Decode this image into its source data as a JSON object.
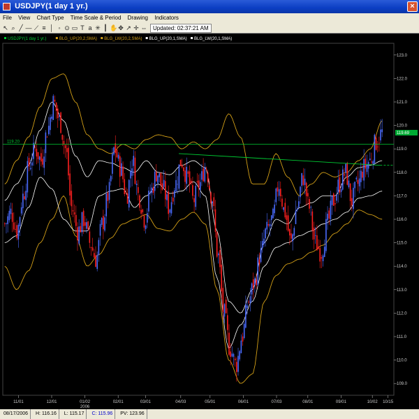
{
  "window": {
    "title": "USDJPY(1 day 1 yr.)",
    "close_glyph": "×"
  },
  "menu": [
    "File",
    "View",
    "Chart Type",
    "Time Scale & Period",
    "Drawing",
    "Indicators"
  ],
  "toolbar": {
    "icons": [
      "arrow-icon",
      "zoom-icon",
      "line-icon",
      "hline-icon",
      "ray-icon",
      "fib-icon",
      "pointer-icon",
      "circle-icon",
      "target-icon",
      "rect-icon",
      "text-icon",
      "abc-icon",
      "fan-icon",
      "vline-icon",
      "hand-icon",
      "move-icon",
      "cursor-icon",
      "cross-icon",
      "pan-icon",
      "zoomout-icon"
    ],
    "updated": "Updated: 02:37:21 AM"
  },
  "status": {
    "date": "08/17/2006",
    "high": "H: 116.16",
    "low": "L: 115.17",
    "close": "C: 115.96",
    "pv": "PV: 123.96"
  },
  "colors": {
    "up_candle": "#4a6bff",
    "down_candle": "#ff2020",
    "upper_band": "#d4a017",
    "mid_band": "#ffffff",
    "trendline": "#00cc33",
    "hline": "#00cc33"
  },
  "chart_data": {
    "type": "line",
    "legend": [
      {
        "name": "USDJPY(1 day 1 yr.)",
        "color": "#00cc33"
      },
      {
        "name": "BLG_UP(20,2,SMA)",
        "color": "#d4a017"
      },
      {
        "name": "BLG_LW(20,2,SMA)",
        "color": "#d4a017"
      },
      {
        "name": "BLG_UP(20,1,SMA)",
        "color": "#ffffff"
      },
      {
        "name": "BLG_LW(20,1,SMA)",
        "color": "#ffffff"
      }
    ],
    "ylim": [
      108.5,
      123.5
    ],
    "yticks": [
      109.0,
      110.0,
      111.0,
      112.0,
      113.0,
      114.0,
      115.0,
      116.0,
      117.0,
      118.0,
      119.0,
      120.0,
      121.0,
      122.0,
      123.0
    ],
    "ytick_labels": [
      "109.0",
      "110.0",
      "111.0",
      "112.0",
      "113.0",
      "114.0",
      "115.0",
      "116.0",
      "117.0",
      "118.0",
      "119.0",
      "120.0",
      "121.0",
      "122.0",
      "123.0"
    ],
    "xticks": [
      {
        "label": "11/01",
        "pos": 0.04
      },
      {
        "label": "12/01",
        "pos": 0.125
      },
      {
        "label": "01/02",
        "sub": "2006",
        "pos": 0.21
      },
      {
        "label": "02/01",
        "pos": 0.295
      },
      {
        "label": "03/01",
        "pos": 0.365
      },
      {
        "label": "04/03",
        "pos": 0.455
      },
      {
        "label": "05/01",
        "pos": 0.53
      },
      {
        "label": "06/01",
        "pos": 0.615
      },
      {
        "label": "07/03",
        "pos": 0.7
      },
      {
        "label": "08/01",
        "pos": 0.78
      },
      {
        "label": "09/01",
        "pos": 0.865
      },
      {
        "label": "10/02",
        "pos": 0.945
      },
      {
        "label": "10/15",
        "pos": 0.985
      }
    ],
    "price_path": [
      115.8,
      116.3,
      115.5,
      117.0,
      118.3,
      119.0,
      118.5,
      119.8,
      121.0,
      120.2,
      119.0,
      116.5,
      115.5,
      116.0,
      115.0,
      114.3,
      115.8,
      117.0,
      119.0,
      118.2,
      117.0,
      118.5,
      117.0,
      116.0,
      117.2,
      118.0,
      117.3,
      116.5,
      117.5,
      118.5,
      117.8,
      116.8,
      117.5,
      118.3,
      117.0,
      114.5,
      112.0,
      110.5,
      109.8,
      111.0,
      112.5,
      113.3,
      114.5,
      115.5,
      116.0,
      117.5,
      116.3,
      115.0,
      116.5,
      117.8,
      116.5,
      115.0,
      114.6,
      115.8,
      116.8,
      117.5,
      118.0,
      116.8,
      117.5,
      118.2,
      118.5,
      119.3,
      119.7
    ],
    "upper2": [
      117.5,
      118.5,
      119.5,
      120.8,
      122.0,
      122.2,
      121.0,
      119.6,
      119.0,
      118.8,
      119.2,
      119.0,
      119.4,
      119.6,
      119.5,
      119.0,
      119.3,
      119.0,
      119.4,
      120.5,
      119.5,
      117.5,
      117.5,
      118.8,
      117.8,
      117.0,
      117.5,
      118.0,
      117.8,
      118.0,
      118.5,
      119.0,
      120.2
    ],
    "mid1_up": [
      116.8,
      117.5,
      118.3,
      119.8,
      121.0,
      120.2,
      118.7,
      117.8,
      118.5,
      118.4,
      118.2,
      118.0,
      118.5,
      118.0,
      117.9,
      118.3,
      118.5,
      118.2,
      115.5,
      112.5,
      112.0,
      113.0,
      115.0,
      116.0,
      115.8,
      116.5,
      116.7,
      117.0,
      117.0,
      117.8,
      118.2,
      118.3,
      118.5
    ],
    "mid1_lw": [
      115.0,
      115.3,
      116.5,
      117.8,
      117.3,
      116.0,
      115.5,
      115.5,
      117.0,
      117.2,
      117.3,
      116.5,
      117.0,
      117.5,
      117.1,
      117.2,
      117.6,
      117.0,
      113.5,
      110.5,
      111.5,
      112.5,
      114.0,
      114.8,
      115.0,
      115.3,
      115.5,
      115.8,
      116.0,
      116.3,
      116.9,
      117.0,
      117.2
    ],
    "lower2": [
      114.0,
      113.0,
      113.8,
      115.0,
      116.0,
      117.0,
      115.3,
      114.0,
      114.5,
      115.2,
      115.8,
      116.0,
      116.2,
      115.6,
      115.5,
      116.0,
      116.3,
      115.8,
      113.0,
      110.0,
      109.0,
      109.4,
      112.5,
      113.6,
      114.1,
      114.3,
      114.6,
      114.9,
      115.4,
      115.8,
      116.4,
      116.2,
      116.0
    ],
    "hline": {
      "label": "119.20",
      "value": 119.2
    },
    "trendline": {
      "from": [
        0.45,
        118.8
      ],
      "to": [
        0.965,
        118.3
      ]
    },
    "last_price": {
      "label": "119.69",
      "value": 119.69
    }
  }
}
